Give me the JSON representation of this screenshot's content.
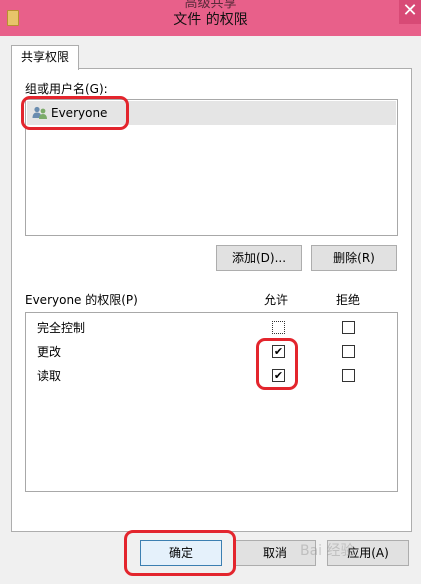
{
  "window": {
    "ghost_title": "高级共享",
    "title": "文件 的权限",
    "close_symbol": "✕"
  },
  "tabs": [
    {
      "label": "共享权限"
    }
  ],
  "groups": {
    "label": "组或用户名(G):",
    "users": [
      {
        "name": "Everyone",
        "icon": "user-group-icon"
      }
    ]
  },
  "buttons": {
    "add": "添加(D)...",
    "remove": "删除(R)",
    "ok": "确定",
    "cancel": "取消",
    "apply": "应用(A)"
  },
  "permissions": {
    "label": "Everyone 的权限(P)",
    "allow_header": "允许",
    "deny_header": "拒绝",
    "rows": [
      {
        "name": "完全控制",
        "allow": false,
        "deny": false
      },
      {
        "name": "更改",
        "allow": true,
        "deny": false
      },
      {
        "name": "读取",
        "allow": true,
        "deny": false
      }
    ]
  },
  "check_symbol": "✔",
  "watermark": "Bai 经验",
  "colors": {
    "titlebar": "#e8608a",
    "annotation": "#e3252d"
  }
}
